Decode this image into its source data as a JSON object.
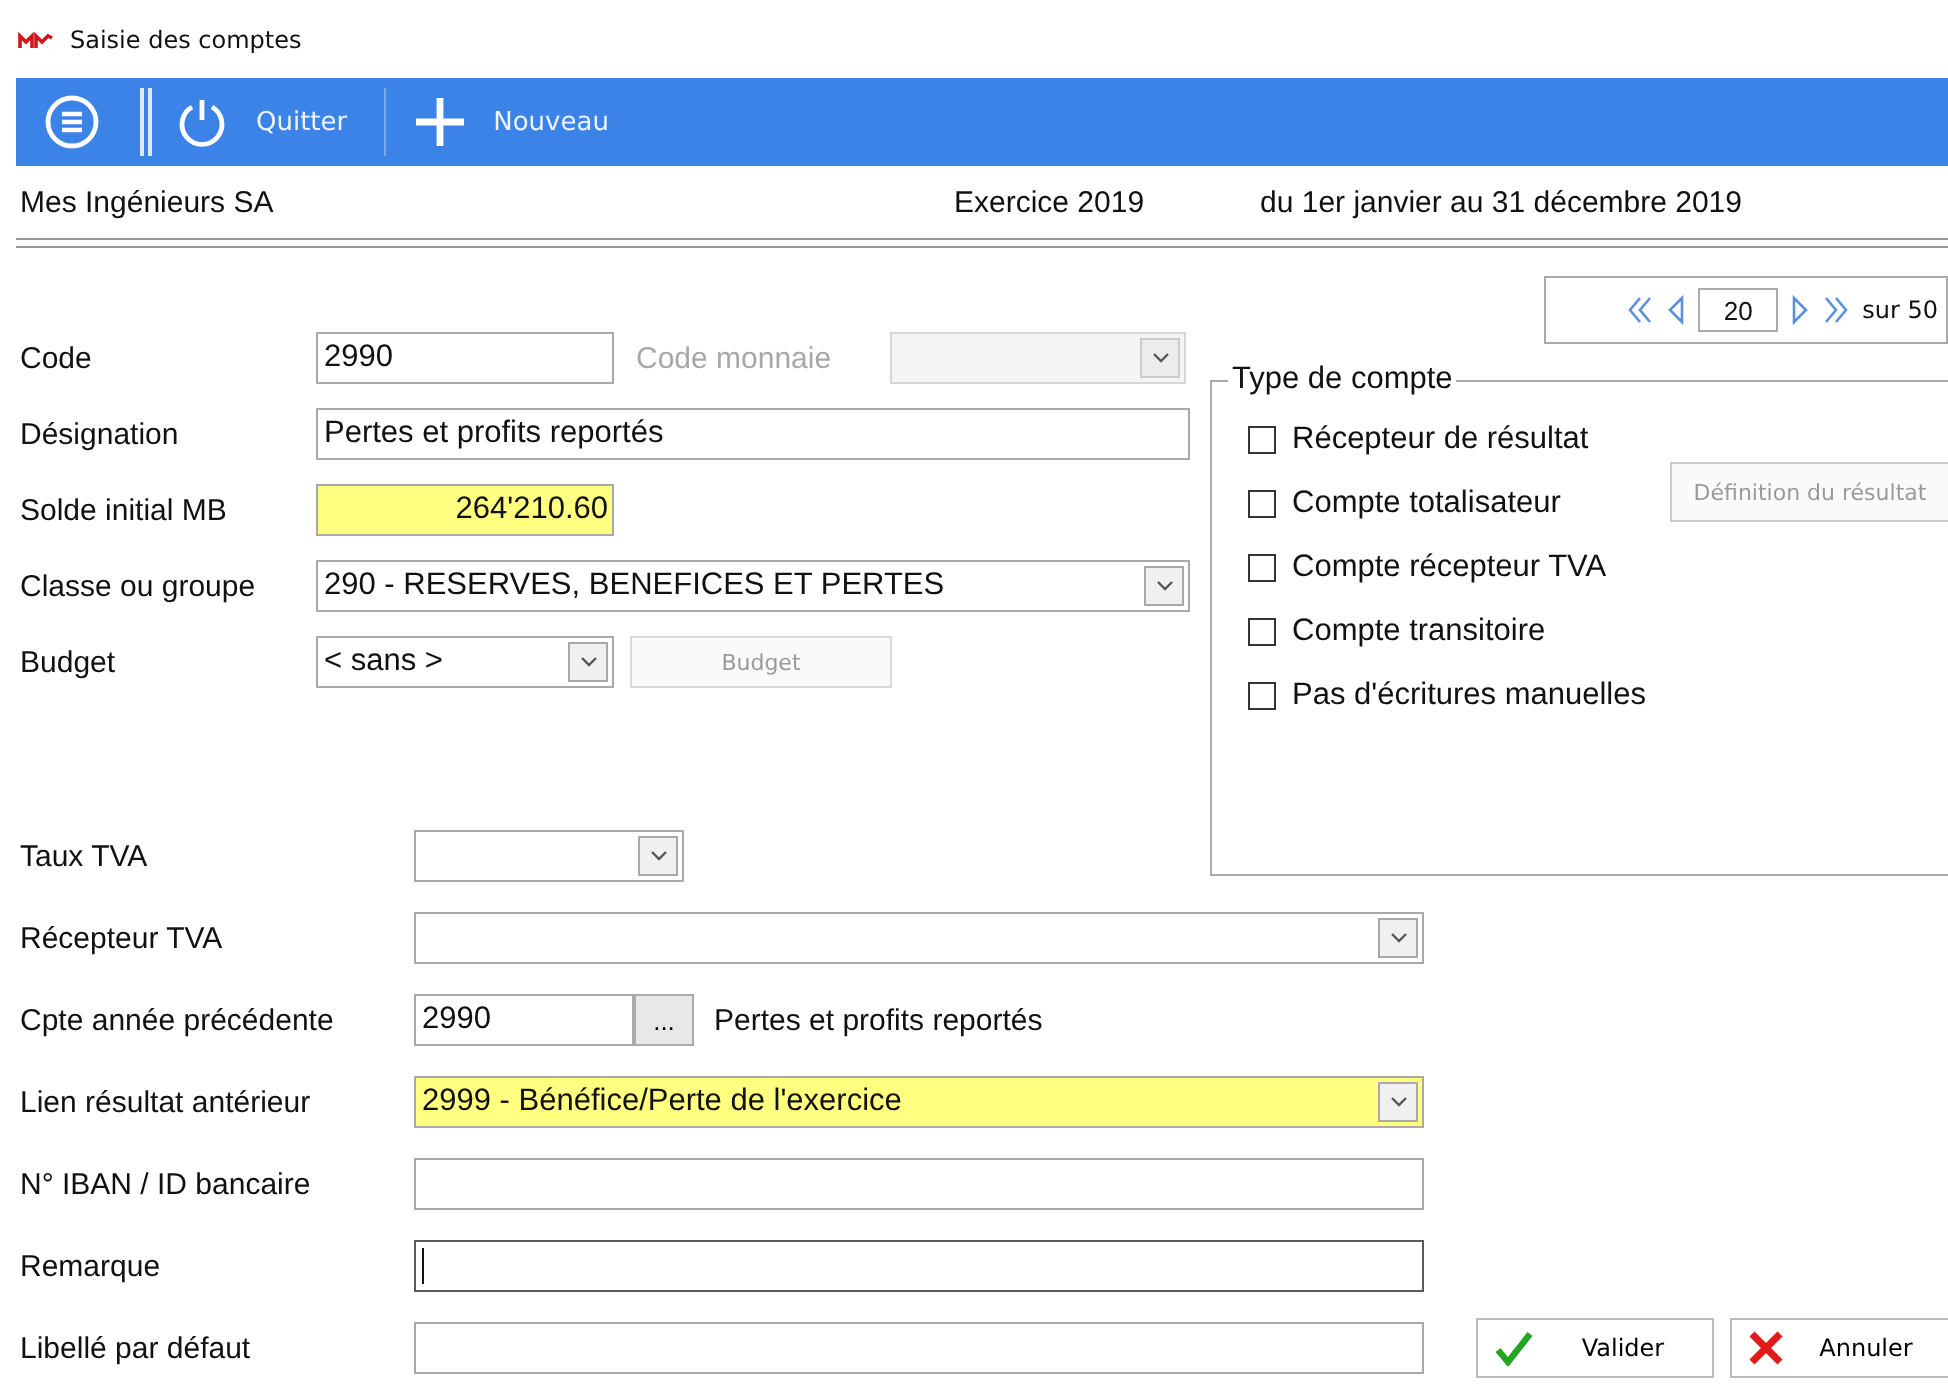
{
  "window": {
    "title": "Saisie des comptes"
  },
  "toolbar": [
    {
      "kind": "menu"
    },
    {
      "kind": "quit",
      "label": "Quitter"
    },
    {
      "kind": "new",
      "label": "Nouveau"
    }
  ],
  "header": {
    "company": "Mes Ingénieurs SA",
    "exercise": "Exercice 2019",
    "period": "du 1er janvier au 31 décembre 2019"
  },
  "pager": {
    "value": "20",
    "total": "sur 50"
  },
  "code": {
    "label": "Code",
    "value": "2990"
  },
  "currency": {
    "label": "Code monnaie",
    "disabled": true
  },
  "designation": {
    "label": "Désignation",
    "value": "Pertes et profits reportés"
  },
  "opening_balance": {
    "label": "Solde initial MB",
    "value": "264'210.60",
    "highlighted": true
  },
  "class_group": {
    "label": "Classe ou groupe",
    "value": "290 - RESERVES, BENEFICES ET PERTES"
  },
  "budget": {
    "label": "Budget",
    "value": "< sans >",
    "button": "Budget",
    "button_disabled": true
  },
  "account_type": {
    "title": "Type de compte",
    "options": [
      {
        "label": "Récepteur de résultat",
        "checked": false
      },
      {
        "label": "Compte totalisateur",
        "checked": false
      },
      {
        "label": "Compte récepteur TVA",
        "checked": false
      },
      {
        "label": "Compte transitoire",
        "checked": false
      },
      {
        "label": "Pas d'écritures manuelles",
        "checked": false
      }
    ],
    "result_button": {
      "label": "Définition du résultat",
      "disabled": true
    }
  },
  "lower_fields": [
    {
      "kind": "short-select",
      "label": "Taux TVA",
      "highlighted": false,
      "focused": false
    },
    {
      "kind": "select",
      "label": "Récepteur TVA",
      "highlighted": false,
      "focused": false
    },
    {
      "kind": "lookup",
      "label": "Cpte année précédente",
      "value": "2990",
      "lookup_button": "...",
      "description": "Pertes et profits reportés",
      "highlighted": false,
      "focused": false
    },
    {
      "kind": "select",
      "label": "Lien résultat antérieur",
      "value": "2999 - Bénéfice/Perte de l'exercice",
      "highlighted": true,
      "focused": false
    },
    {
      "kind": "text",
      "label": "N° IBAN / ID bancaire",
      "highlighted": false,
      "focused": false
    },
    {
      "kind": "text",
      "label": "Remarque",
      "highlighted": false,
      "focused": true
    },
    {
      "kind": "text",
      "label": "Libellé par défaut",
      "highlighted": false,
      "focused": false
    }
  ],
  "buttons": [
    {
      "kind": "ok",
      "label": "Valider"
    },
    {
      "kind": "cancel",
      "label": "Annuler"
    }
  ]
}
